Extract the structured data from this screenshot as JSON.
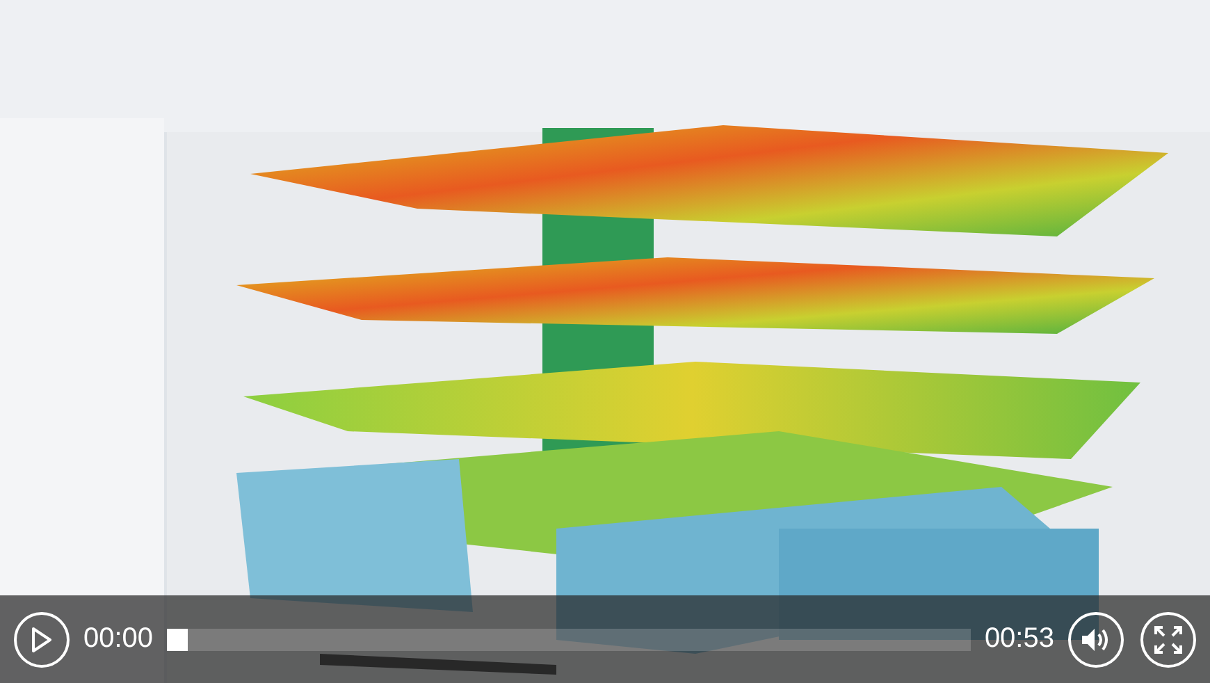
{
  "player": {
    "elapsed": "00:00",
    "progress": {
      "level": 0
    },
    "duration": "00:53"
  }
}
